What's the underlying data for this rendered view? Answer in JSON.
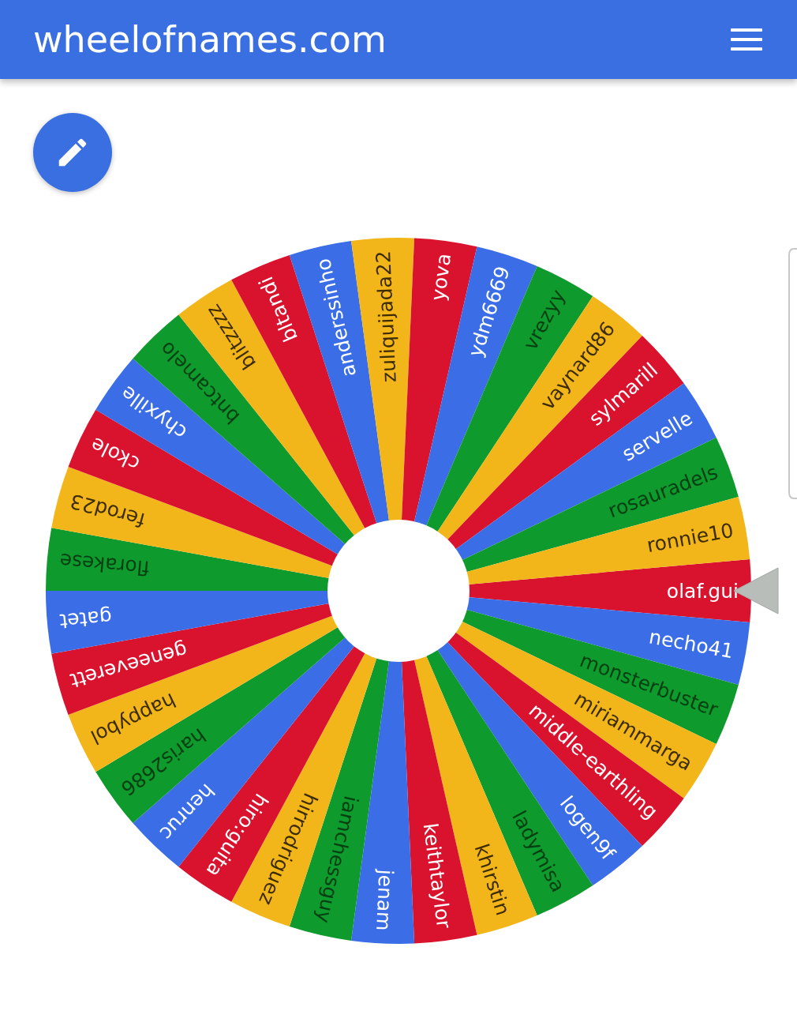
{
  "header": {
    "title": "wheelofnames.com"
  },
  "wheel": {
    "segments": [
      {
        "name": "olaf.gui",
        "color": "#d9132e"
      },
      {
        "name": "necho41",
        "color": "#3b6ee6"
      },
      {
        "name": "monsterbuster",
        "color": "#0e9a2d"
      },
      {
        "name": "miriammarga",
        "color": "#f2b61a"
      },
      {
        "name": "middle-earthling",
        "color": "#d9132e"
      },
      {
        "name": "logen9f",
        "color": "#3b6ee6"
      },
      {
        "name": "ladymisa",
        "color": "#0e9a2d"
      },
      {
        "name": "khirstin",
        "color": "#f2b61a"
      },
      {
        "name": "keithtaylor",
        "color": "#d9132e"
      },
      {
        "name": "jenam",
        "color": "#3b6ee6"
      },
      {
        "name": "iamchessguy",
        "color": "#0e9a2d"
      },
      {
        "name": "hirrodriguez",
        "color": "#f2b61a"
      },
      {
        "name": "hiro:guita",
        "color": "#d9132e"
      },
      {
        "name": "henruc",
        "color": "#3b6ee6"
      },
      {
        "name": "haris2686",
        "color": "#0e9a2d"
      },
      {
        "name": "happybol",
        "color": "#f2b61a"
      },
      {
        "name": "geneeverett",
        "color": "#d9132e"
      },
      {
        "name": "gatet",
        "color": "#3b6ee6"
      },
      {
        "name": "florakese",
        "color": "#0e9a2d"
      },
      {
        "name": "ferod23",
        "color": "#f2b61a"
      },
      {
        "name": "ckole",
        "color": "#d9132e"
      },
      {
        "name": "chyxille",
        "color": "#3b6ee6"
      },
      {
        "name": "bntcamelo",
        "color": "#0e9a2d"
      },
      {
        "name": "blitzzzz",
        "color": "#f2b61a"
      },
      {
        "name": "bltandi",
        "color": "#d9132e"
      },
      {
        "name": "anderssinho",
        "color": "#3b6ee6"
      },
      {
        "name": "zuliquijada22",
        "color": "#f2b61a"
      },
      {
        "name": "yova",
        "color": "#d9132e"
      },
      {
        "name": "ydm6669",
        "color": "#3b6ee6"
      },
      {
        "name": "vrezyy",
        "color": "#0e9a2d"
      },
      {
        "name": "vaynard86",
        "color": "#f2b61a"
      },
      {
        "name": "sylmarill",
        "color": "#d9132e"
      },
      {
        "name": "servelle",
        "color": "#3b6ee6"
      },
      {
        "name": "rosauradels",
        "color": "#0e9a2d"
      },
      {
        "name": "ronnie10",
        "color": "#f2b61a"
      }
    ]
  }
}
